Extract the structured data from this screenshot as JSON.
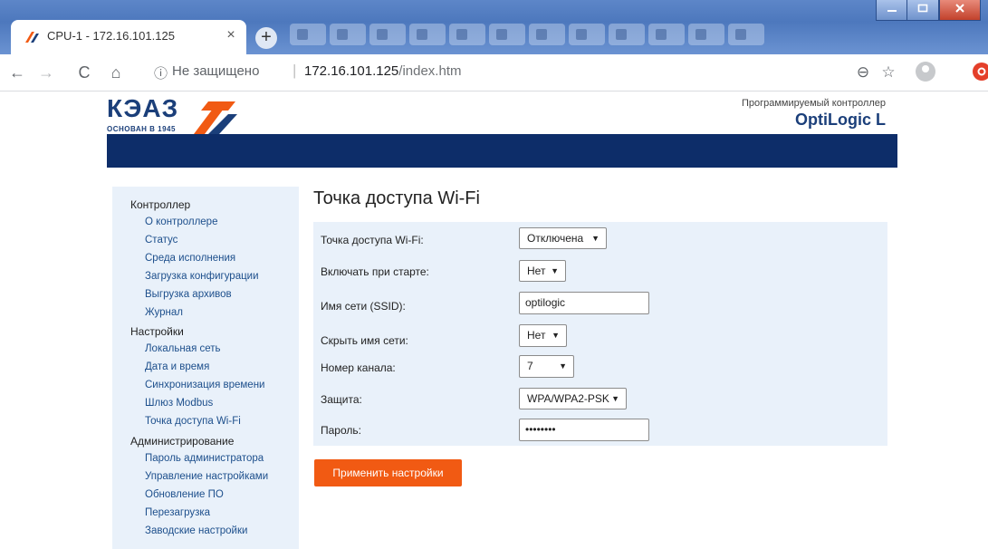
{
  "browser": {
    "tab_title": "CPU-1 - 172.16.101.125",
    "tab_close": "×",
    "new_tab": "+",
    "security_text": "Не защищено",
    "url_separator": "|",
    "url_host": "172.16.101.125",
    "url_path": "/index.htm"
  },
  "header": {
    "logo_text": "КЭАЗ",
    "logo_tagline": "ОСНОВАН В 1945",
    "product_caption": "Программируемый контроллер",
    "product_name": "OptiLogic L",
    "brand_color": "#0d2d69",
    "accent_color": "#f15a13"
  },
  "sidebar": {
    "groups": [
      {
        "label": "Контроллер",
        "items": [
          "О контроллере",
          "Статус",
          "Среда исполнения",
          "Загрузка конфигурации",
          "Выгрузка архивов",
          "Журнал"
        ]
      },
      {
        "label": "Настройки",
        "items": [
          "Локальная сеть",
          "Дата и время",
          "Синхронизация времени",
          "Шлюз Modbus",
          "Точка доступа Wi-Fi"
        ]
      },
      {
        "label": "Администрирование",
        "items": [
          "Пароль администратора",
          "Управление настройками",
          "Обновление ПО",
          "Перезагрузка",
          "Заводские настройки"
        ]
      }
    ]
  },
  "main": {
    "title": "Точка доступа Wi-Fi",
    "fields": {
      "wifi_ap": {
        "label": "Точка доступа Wi-Fi:",
        "value": "Отключена"
      },
      "on_start": {
        "label": "Включать при старте:",
        "value": "Нет"
      },
      "ssid": {
        "label": "Имя сети (SSID):",
        "value": "optilogic"
      },
      "hide_ssid": {
        "label": "Скрыть имя сети:",
        "value": "Нет"
      },
      "channel": {
        "label": "Номер канала:",
        "value": "7"
      },
      "security": {
        "label": "Защита:",
        "value": "WPA/WPA2-PSK"
      },
      "password": {
        "label": "Пароль:",
        "value": "••••••••"
      }
    },
    "apply_label": "Применить настройки"
  },
  "icons": {
    "dropdown_caret": "▼",
    "back": "←",
    "forward": "→",
    "reload": "C",
    "home": "⌂",
    "info": "ⓘ",
    "zoom": "⊖",
    "star": "☆"
  }
}
